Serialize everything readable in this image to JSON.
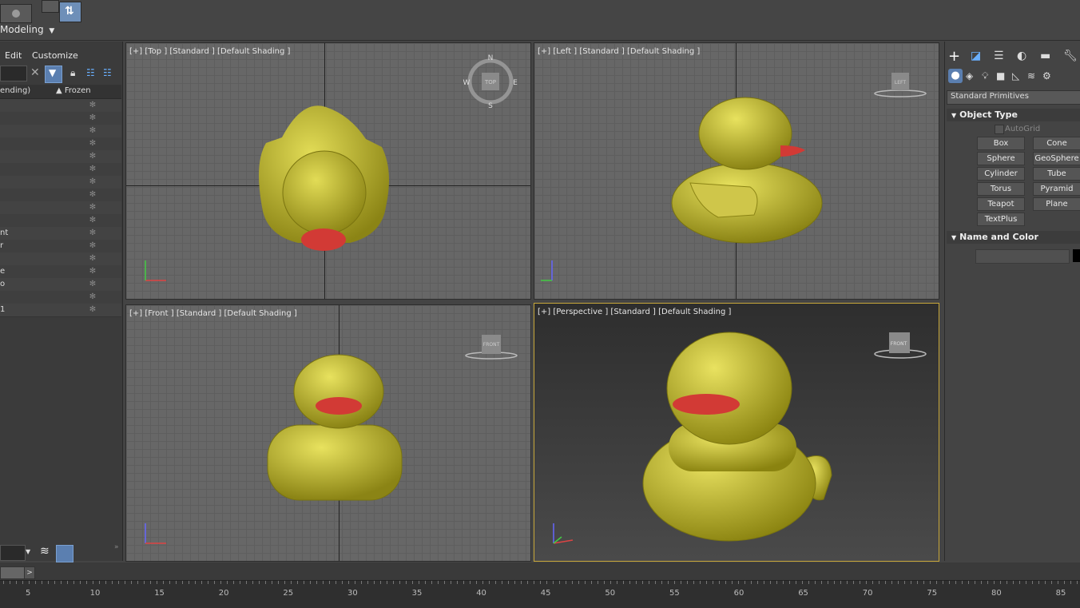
{
  "top": {
    "workspace": "Modeling"
  },
  "explorer": {
    "menu": [
      "Edit",
      "Customize"
    ],
    "header_col1": "ending)",
    "header_col2": "▲ Frozen",
    "rows": [
      {
        "name": ""
      },
      {
        "name": ""
      },
      {
        "name": ""
      },
      {
        "name": ""
      },
      {
        "name": ""
      },
      {
        "name": ""
      },
      {
        "name": ""
      },
      {
        "name": ""
      },
      {
        "name": ""
      },
      {
        "name": ""
      },
      {
        "name": "nt"
      },
      {
        "name": "r"
      },
      {
        "name": ""
      },
      {
        "name": "e"
      },
      {
        "name": "o"
      },
      {
        "name": ""
      },
      {
        "name": "1"
      }
    ],
    "frozen_glyph": "✻"
  },
  "viewports": {
    "top": {
      "label": "[+] [Top ] [Standard ] [Default Shading ]"
    },
    "left": {
      "label": "[+] [Left ] [Standard ] [Default Shading ]"
    },
    "front": {
      "label": "[+] [Front ] [Standard ] [Default Shading ]"
    },
    "perspective": {
      "label": "[+] [Perspective ] [Standard ] [Default Shading ]"
    }
  },
  "viewcube": {
    "top": "TOP",
    "left": "LEFT",
    "front": "FRONT",
    "persp": "FRONT",
    "n": "N",
    "s": "S",
    "e": "E",
    "w": "W"
  },
  "command_panel": {
    "category": "Standard Primitives",
    "object_type_title": "Object Type",
    "autogrid": "AutoGrid",
    "buttons": [
      "Box",
      "Cone",
      "Sphere",
      "GeoSphere",
      "Cylinder",
      "Tube",
      "Torus",
      "Pyramid",
      "Teapot",
      "Plane",
      "TextPlus"
    ],
    "name_color_title": "Name and Color"
  },
  "timeline": {
    "ticks": [
      "5",
      "10",
      "15",
      "20",
      "25",
      "30",
      "35",
      "40",
      "45",
      "50",
      "55",
      "60",
      "65",
      "70",
      "75",
      "80",
      "85"
    ]
  },
  "colors": {
    "duck_body": "#c9c02e",
    "duck_beak": "#d23a35",
    "viewport_bg": "#676767",
    "active_border": "#c8a83a"
  }
}
